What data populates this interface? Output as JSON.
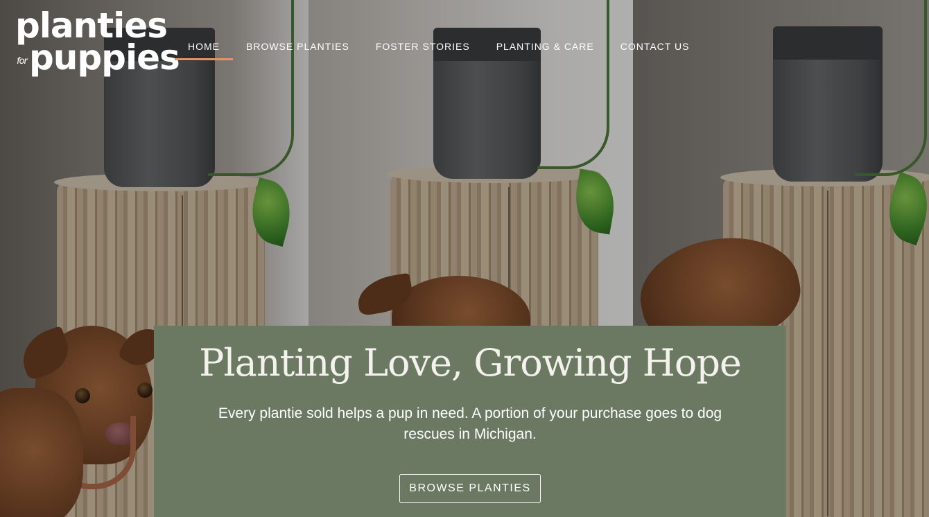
{
  "brand": {
    "logo_line1": "planties",
    "logo_for": "for",
    "logo_line2": "puppies"
  },
  "nav": {
    "items": [
      {
        "label": "HOME",
        "active": true
      },
      {
        "label": "BROWSE PLANTIES",
        "active": false
      },
      {
        "label": "FOSTER STORIES",
        "active": false
      },
      {
        "label": "PLANTING & CARE",
        "active": false
      },
      {
        "label": "CONTACT US",
        "active": false
      }
    ],
    "active_underline_color": "#e59466"
  },
  "hero": {
    "title": "Planting Love, Growing Hope",
    "subtitle": "Every plantie sold helps a pup in need. A portion of your purchase goes to dog rescues in Michigan.",
    "cta_label": "BROWSE PLANTIES",
    "card_color": "#6b7963"
  },
  "background": {
    "panels": [
      "pothos-plant-on-stump-with-dog",
      "dog-sniffing-stump",
      "dog-peeking-behind-stump"
    ]
  }
}
